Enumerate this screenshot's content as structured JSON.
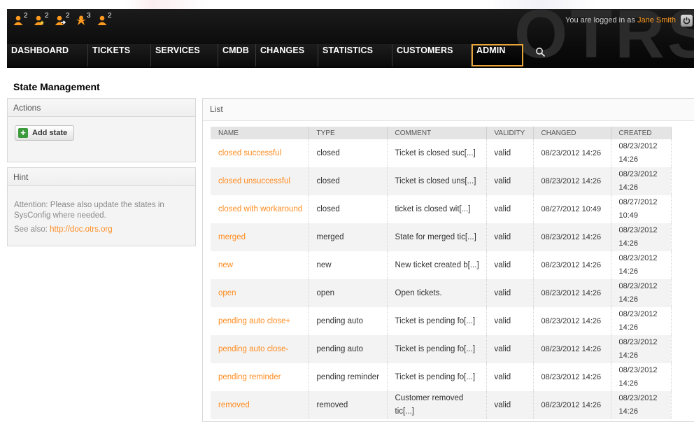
{
  "toolbar": {
    "items": [
      {
        "icon": "user-icon",
        "count": "2"
      },
      {
        "icon": "user-star-icon",
        "count": "2"
      },
      {
        "icon": "user-arrow-icon",
        "count": "2"
      },
      {
        "icon": "user-alert-icon",
        "count": "3"
      },
      {
        "icon": "user-icon",
        "count": "2"
      }
    ]
  },
  "header": {
    "login_prefix": "You are logged in as ",
    "user_name": "Jane Smith"
  },
  "nav": {
    "items": [
      "DASHBOARD",
      "TICKETS",
      "SERVICES",
      "CMDB",
      "CHANGES",
      "STATISTICS",
      "CUSTOMERS",
      "ADMIN"
    ],
    "selected": "ADMIN"
  },
  "page": {
    "title": "State Management"
  },
  "actions": {
    "title": "Actions",
    "add_label": "Add state"
  },
  "hint": {
    "title": "Hint",
    "text": "Attention: Please also update the states in SysConfig where needed.",
    "see_also": "See also: ",
    "link": "http://doc.otrs.org"
  },
  "list": {
    "title": "List",
    "columns": [
      "NAME",
      "TYPE",
      "COMMENT",
      "VALIDITY",
      "CHANGED",
      "CREATED"
    ],
    "rows": [
      {
        "name": "closed successful",
        "type": "closed",
        "comment": "Ticket is closed suc[...]",
        "validity": "valid",
        "changed": "08/23/2012 14:26",
        "created": "08/23/2012 14:26"
      },
      {
        "name": "closed unsuccessful",
        "type": "closed",
        "comment": "Ticket is closed uns[...]",
        "validity": "valid",
        "changed": "08/23/2012 14:26",
        "created": "08/23/2012 14:26"
      },
      {
        "name": "closed with workaround",
        "type": "closed",
        "comment": "ticket is closed wit[...]",
        "validity": "valid",
        "changed": "08/27/2012 10:49",
        "created": "08/27/2012 10:49"
      },
      {
        "name": "merged",
        "type": "merged",
        "comment": "State for merged tic[...]",
        "validity": "valid",
        "changed": "08/23/2012 14:26",
        "created": "08/23/2012 14:26"
      },
      {
        "name": "new",
        "type": "new",
        "comment": "New ticket created b[...]",
        "validity": "valid",
        "changed": "08/23/2012 14:26",
        "created": "08/23/2012 14:26"
      },
      {
        "name": "open",
        "type": "open",
        "comment": "Open tickets.",
        "validity": "valid",
        "changed": "08/23/2012 14:26",
        "created": "08/23/2012 14:26"
      },
      {
        "name": "pending auto close+",
        "type": "pending auto",
        "comment": "Ticket is pending fo[...]",
        "validity": "valid",
        "changed": "08/23/2012 14:26",
        "created": "08/23/2012 14:26"
      },
      {
        "name": "pending auto close-",
        "type": "pending auto",
        "comment": "Ticket is pending fo[...]",
        "validity": "valid",
        "changed": "08/23/2012 14:26",
        "created": "08/23/2012 14:26"
      },
      {
        "name": "pending reminder",
        "type": "pending reminder",
        "comment": "Ticket is pending fo[...]",
        "validity": "valid",
        "changed": "08/23/2012 14:26",
        "created": "08/23/2012 14:26"
      },
      {
        "name": "removed",
        "type": "removed",
        "comment": "Customer removed tic[...]",
        "validity": "valid",
        "changed": "08/23/2012 14:26",
        "created": "08/23/2012 14:26"
      }
    ]
  },
  "colors": {
    "accent": "#ff8b1f",
    "nav_selected_border": "#e8a33a",
    "header_bg": "#0d0d0d"
  }
}
